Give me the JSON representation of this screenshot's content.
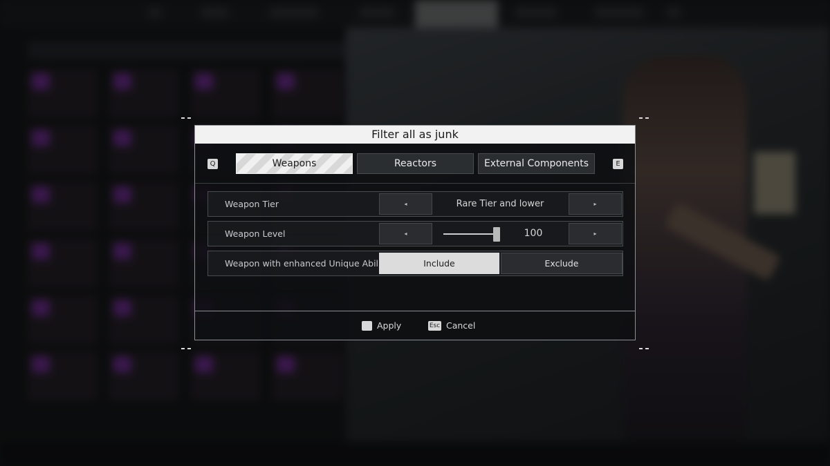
{
  "dialog": {
    "title": "Filter all as junk",
    "prev_key": "Q",
    "next_key": "E",
    "tabs": [
      {
        "label": "Weapons",
        "active": true
      },
      {
        "label": "Reactors",
        "active": false
      },
      {
        "label": "External Components",
        "active": false
      }
    ],
    "rows": {
      "tier": {
        "label": "Weapon Tier",
        "value": "Rare Tier and lower"
      },
      "level": {
        "label": "Weapon Level",
        "value": "100",
        "slider_fraction": 1.0
      },
      "ability": {
        "label": "Weapon with enhanced Unique Ability",
        "include_label": "Include",
        "exclude_label": "Exclude",
        "selected": "Include"
      }
    },
    "footer": {
      "apply_key": "",
      "apply_label": "Apply",
      "cancel_key": "Esc",
      "cancel_label": "Cancel"
    }
  },
  "icons": {
    "left_arrow": "◂",
    "right_arrow": "▸"
  },
  "colors": {
    "title_bg": "#f2f2f2",
    "active_tab": "#f0f0f0",
    "selected_toggle": "#dcdcdc",
    "inventory_accent": "#6a2c8c"
  }
}
